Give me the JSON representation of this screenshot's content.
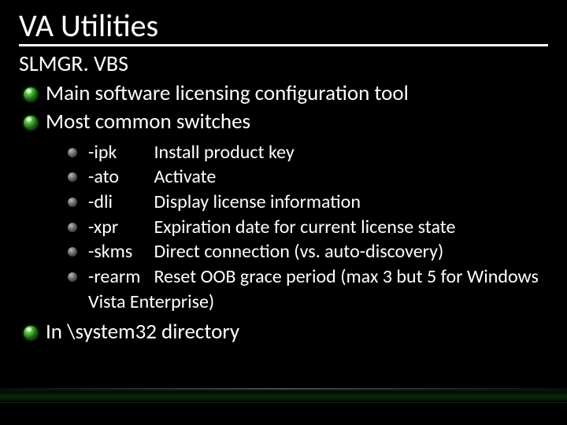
{
  "title": "VA Utilities",
  "subtitle": "SLMGR. VBS",
  "bullets": {
    "b1": "Main software licensing configuration tool",
    "b2": "Most common switches",
    "b3": "In \\system32 directory"
  },
  "switches": [
    {
      "flag": "-ipk",
      "desc": "Install product key"
    },
    {
      "flag": "-ato",
      "desc": "Activate"
    },
    {
      "flag": "-dli",
      "desc": "Display license information"
    },
    {
      "flag": "-xpr",
      "desc": "Expiration date for current license state"
    },
    {
      "flag": "-skms",
      "desc": "Direct connection (vs. auto-discovery)"
    },
    {
      "flag": "-rearm",
      "desc": "Reset OOB grace period (max 3 but 5 for Windows Vista Enterprise)"
    }
  ]
}
